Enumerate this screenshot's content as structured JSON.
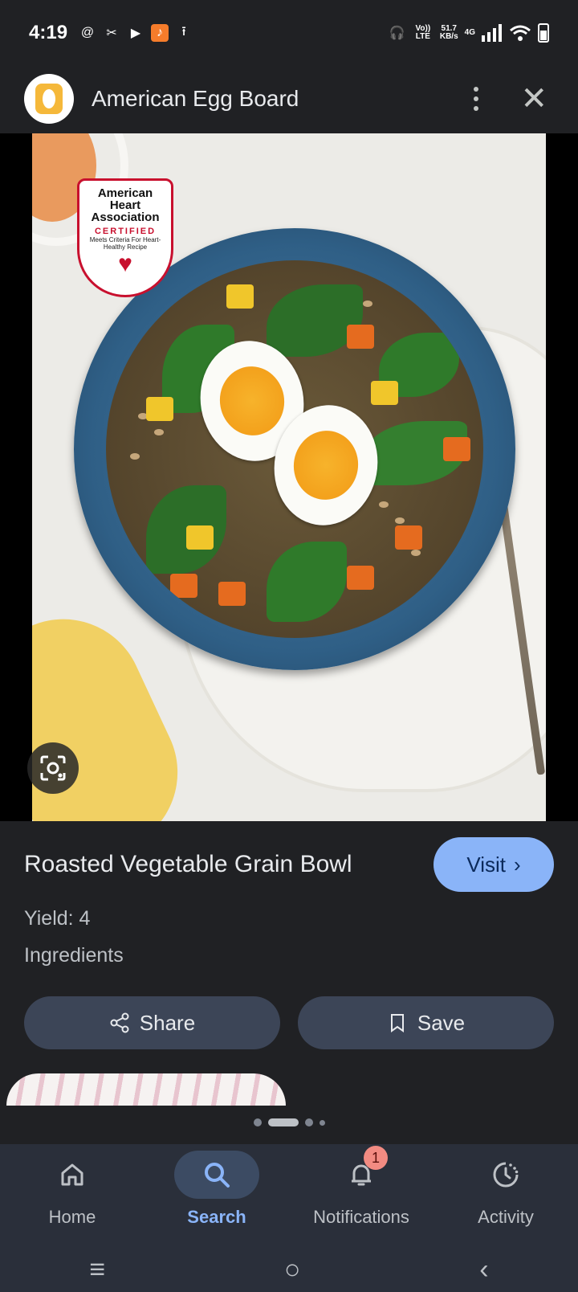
{
  "status_bar": {
    "time": "4:19",
    "network_speed_value": "51.7",
    "network_speed_unit": "KB/s",
    "volte_label": "Vo)) LTE",
    "network_type": "4G"
  },
  "header": {
    "source_name": "American Egg Board"
  },
  "image": {
    "badge_line1": "American Heart Association",
    "badge_line2": "CERTIFIED",
    "badge_line3": "Meets Criteria For Heart-Healthy Recipe"
  },
  "recipe": {
    "title": "Roasted Vegetable Grain Bowl",
    "visit_label": "Visit",
    "yield": "Yield: 4",
    "ingredients_label": "Ingredients",
    "share_label": "Share",
    "save_label": "Save"
  },
  "pager": {
    "total": 4,
    "active_index": 1
  },
  "bottom_nav": {
    "items": [
      {
        "label": "Home",
        "icon": "home-icon"
      },
      {
        "label": "Search",
        "icon": "search-icon",
        "active": true
      },
      {
        "label": "Notifications",
        "icon": "bell-icon",
        "badge": "1"
      },
      {
        "label": "Activity",
        "icon": "activity-icon"
      }
    ]
  },
  "colors": {
    "accent": "#8ab4f8",
    "background": "#202124",
    "pill": "#3c4557",
    "badge": "#f28b82"
  }
}
